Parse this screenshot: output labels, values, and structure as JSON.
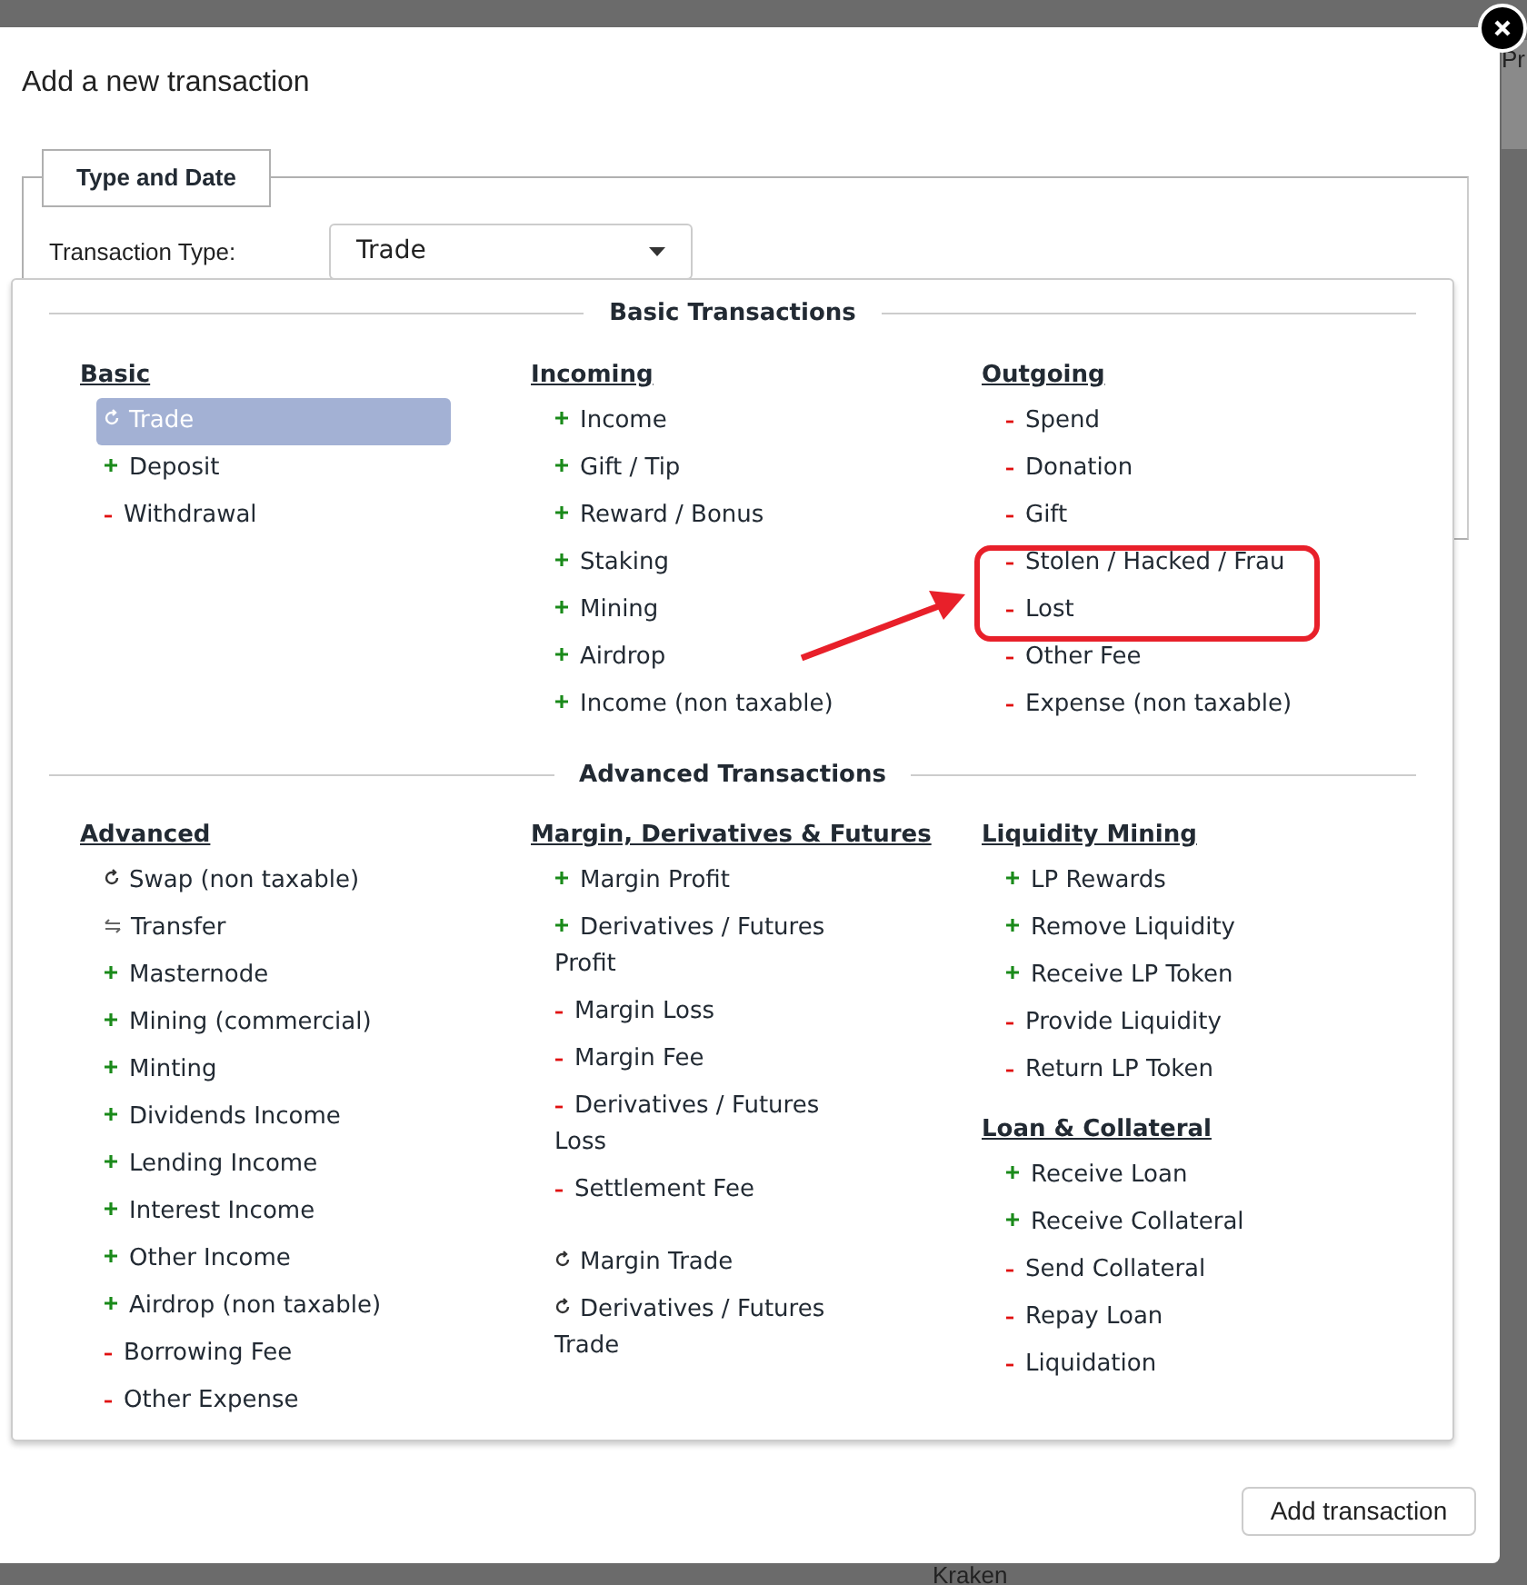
{
  "backdrop": [
    {
      "text": "Pr"
    },
    {
      "text": "Kraken"
    }
  ],
  "dialog": {
    "title": "Add a new transaction",
    "legend": "Type and Date",
    "type_label": "Transaction Type:",
    "type_value": "Trade",
    "submit": "Add transaction"
  },
  "sections": [
    {
      "title": "Basic Transactions",
      "columns": [
        [
          {
            "heading": "Basic",
            "items": [
              {
                "label": "Trade",
                "kind": "cycle",
                "selected": true
              },
              {
                "label": "Deposit",
                "kind": "plus",
                "selected": false
              },
              {
                "label": "Withdrawal",
                "kind": "minus",
                "selected": false
              }
            ]
          }
        ],
        [
          {
            "heading": "Incoming",
            "items": [
              {
                "label": "Income",
                "kind": "plus",
                "selected": false
              },
              {
                "label": "Gift / Tip",
                "kind": "plus",
                "selected": false
              },
              {
                "label": "Reward / Bonus",
                "kind": "plus",
                "selected": false
              },
              {
                "label": "Staking",
                "kind": "plus",
                "selected": false
              },
              {
                "label": "Mining",
                "kind": "plus",
                "selected": false
              },
              {
                "label": "Airdrop",
                "kind": "plus",
                "selected": false
              },
              {
                "label": "Income (non taxable)",
                "kind": "plus",
                "selected": false
              }
            ]
          }
        ],
        [
          {
            "heading": "Outgoing",
            "items": [
              {
                "label": "Spend",
                "kind": "minus",
                "selected": false
              },
              {
                "label": "Donation",
                "kind": "minus",
                "selected": false
              },
              {
                "label": "Gift",
                "kind": "minus",
                "selected": false
              },
              {
                "label": "Stolen / Hacked / Frau",
                "kind": "minus",
                "selected": false
              },
              {
                "label": "Lost",
                "kind": "minus",
                "selected": false
              },
              {
                "label": "Other Fee",
                "kind": "minus",
                "selected": false
              },
              {
                "label": "Expense (non taxable)",
                "kind": "minus",
                "selected": false
              }
            ]
          }
        ]
      ]
    },
    {
      "title": "Advanced Transactions",
      "columns": [
        [
          {
            "heading": "Advanced",
            "items": [
              {
                "label": "Swap (non taxable)",
                "kind": "cycle",
                "selected": false
              },
              {
                "label": "Transfer",
                "kind": "transfer",
                "selected": false
              },
              {
                "label": "Masternode",
                "kind": "plus",
                "selected": false
              },
              {
                "label": "Mining (commercial)",
                "kind": "plus",
                "selected": false
              },
              {
                "label": "Minting",
                "kind": "plus",
                "selected": false
              },
              {
                "label": "Dividends Income",
                "kind": "plus",
                "selected": false
              },
              {
                "label": "Lending Income",
                "kind": "plus",
                "selected": false
              },
              {
                "label": "Interest Income",
                "kind": "plus",
                "selected": false
              },
              {
                "label": "Other Income",
                "kind": "plus",
                "selected": false
              },
              {
                "label": "Airdrop (non taxable)",
                "kind": "plus",
                "selected": false
              },
              {
                "label": "Borrowing Fee",
                "kind": "minus",
                "selected": false
              },
              {
                "label": "Other Expense",
                "kind": "minus",
                "selected": false
              }
            ]
          }
        ],
        [
          {
            "heading": "Margin, Derivatives & Futures",
            "items": [
              {
                "label": "Margin Profit",
                "kind": "plus",
                "selected": false
              },
              {
                "label": "Derivatives / Futures Profit",
                "kind": "plus",
                "selected": false
              },
              {
                "label": "Margin Loss",
                "kind": "minus",
                "selected": false
              },
              {
                "label": "Margin Fee",
                "kind": "minus",
                "selected": false
              },
              {
                "label": "Derivatives / Futures Loss",
                "kind": "minus",
                "selected": false
              },
              {
                "label": "Settlement Fee",
                "kind": "minus",
                "selected": false
              },
              {
                "label": "Margin Trade",
                "kind": "cycle",
                "selected": false,
                "separated": true
              },
              {
                "label": "Derivatives / Futures Trade",
                "kind": "cycle",
                "selected": false
              }
            ]
          }
        ],
        [
          {
            "heading": "Liquidity Mining",
            "items": [
              {
                "label": "LP Rewards",
                "kind": "plus",
                "selected": false
              },
              {
                "label": "Remove Liquidity",
                "kind": "plus",
                "selected": false
              },
              {
                "label": "Receive LP Token",
                "kind": "plus",
                "selected": false
              },
              {
                "label": "Provide Liquidity",
                "kind": "minus",
                "selected": false
              },
              {
                "label": "Return LP Token",
                "kind": "minus",
                "selected": false
              }
            ]
          },
          {
            "heading": "Loan & Collateral",
            "items": [
              {
                "label": "Receive Loan",
                "kind": "plus",
                "selected": false
              },
              {
                "label": "Receive Collateral",
                "kind": "plus",
                "selected": false
              },
              {
                "label": "Send Collateral",
                "kind": "minus",
                "selected": false
              },
              {
                "label": "Repay Loan",
                "kind": "minus",
                "selected": false
              },
              {
                "label": "Liquidation",
                "kind": "minus",
                "selected": false
              }
            ]
          }
        ]
      ]
    }
  ]
}
